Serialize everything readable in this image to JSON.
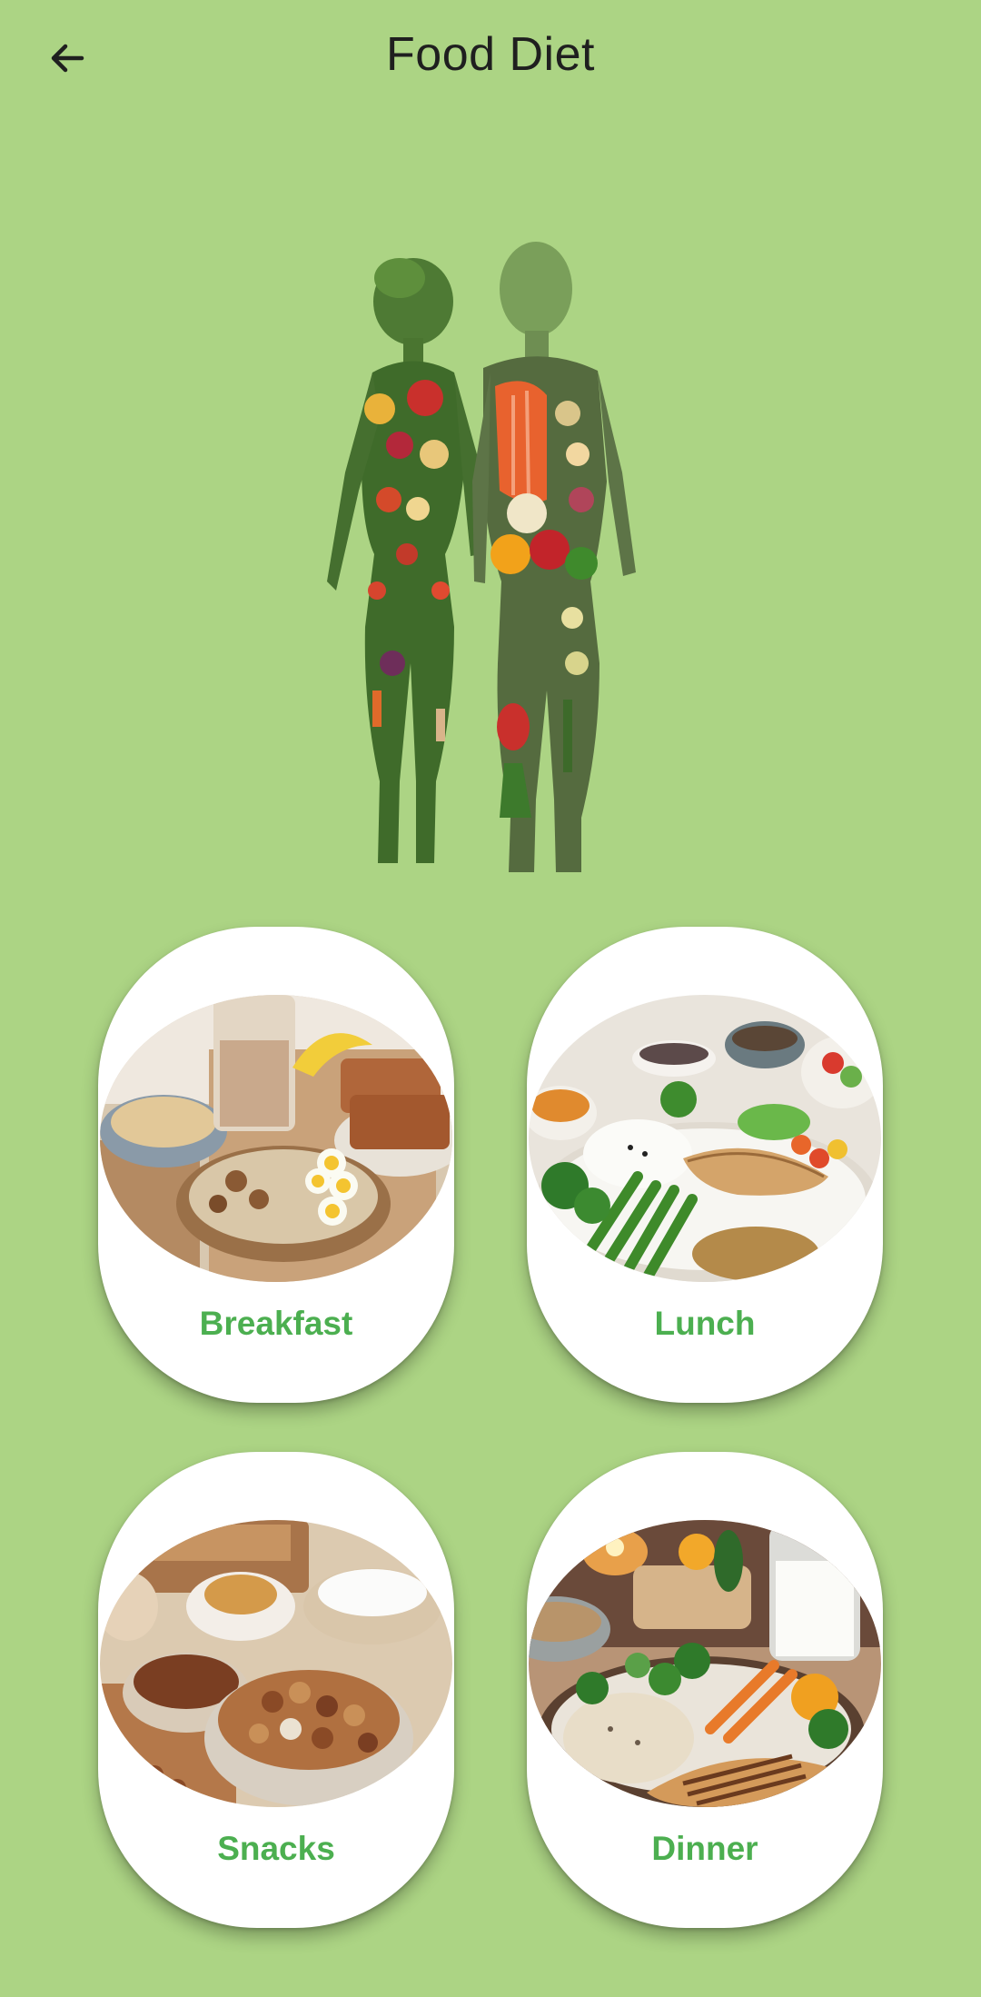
{
  "header": {
    "title": "Food Diet",
    "back_icon": "arrow-back-icon"
  },
  "hero": {
    "icon": "food-body-illustration"
  },
  "categories": [
    {
      "label": "Breakfast",
      "icon": "breakfast-photo"
    },
    {
      "label": "Lunch",
      "icon": "lunch-photo"
    },
    {
      "label": "Snacks",
      "icon": "snacks-photo"
    },
    {
      "label": "Dinner",
      "icon": "dinner-photo"
    }
  ],
  "colors": {
    "background": "#acd484",
    "card": "#ffffff",
    "label_green": "#4caf50",
    "title_text": "#1f1f1f"
  }
}
